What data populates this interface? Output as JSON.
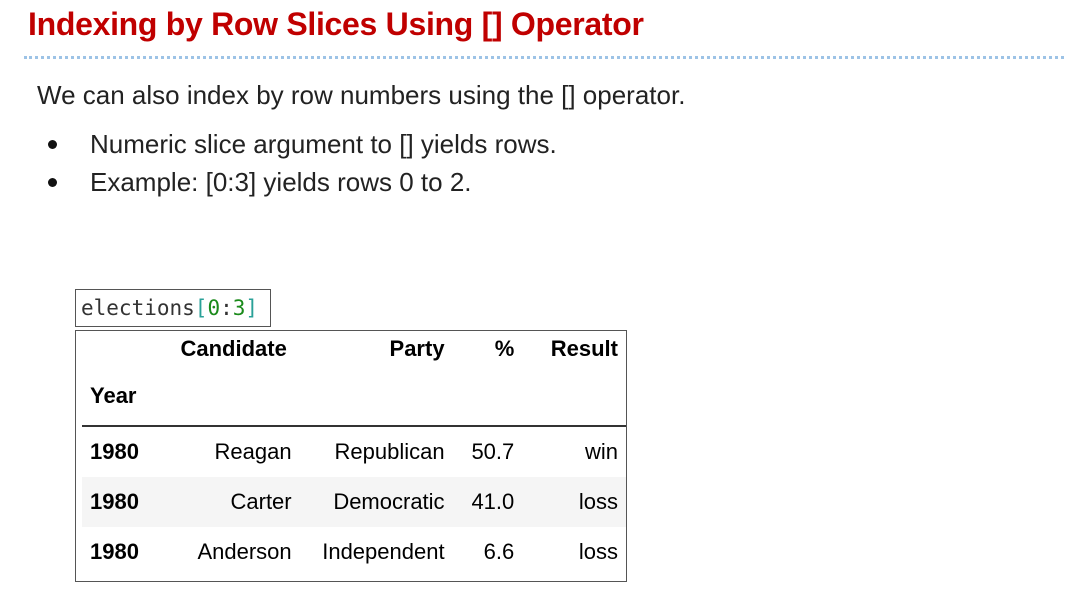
{
  "slide": {
    "title": "Indexing by Row Slices Using [] Operator",
    "intro": "We can also index by row numbers using the [] operator.",
    "bullets": [
      "Numeric slice argument to [] yields rows.",
      "Example: [0:3] yields rows 0 to 2."
    ]
  },
  "code": {
    "name": "elections",
    "open": "[",
    "start": "0",
    "colon": ":",
    "stop": "3",
    "close": "]"
  },
  "dataframe": {
    "columns": [
      "Candidate",
      "Party",
      "%",
      "Result"
    ],
    "index_name": "Year",
    "rows": [
      {
        "index": "1980",
        "Candidate": "Reagan",
        "Party": "Republican",
        "pct": "50.7",
        "Result": "win"
      },
      {
        "index": "1980",
        "Candidate": "Carter",
        "Party": "Democratic",
        "pct": "41.0",
        "Result": "loss"
      },
      {
        "index": "1980",
        "Candidate": "Anderson",
        "Party": "Independent",
        "pct": "6.6",
        "Result": "loss"
      }
    ]
  },
  "colors": {
    "title": "#c00000",
    "divider": "#9dc3e6",
    "row_shade": "#f5f5f5"
  }
}
